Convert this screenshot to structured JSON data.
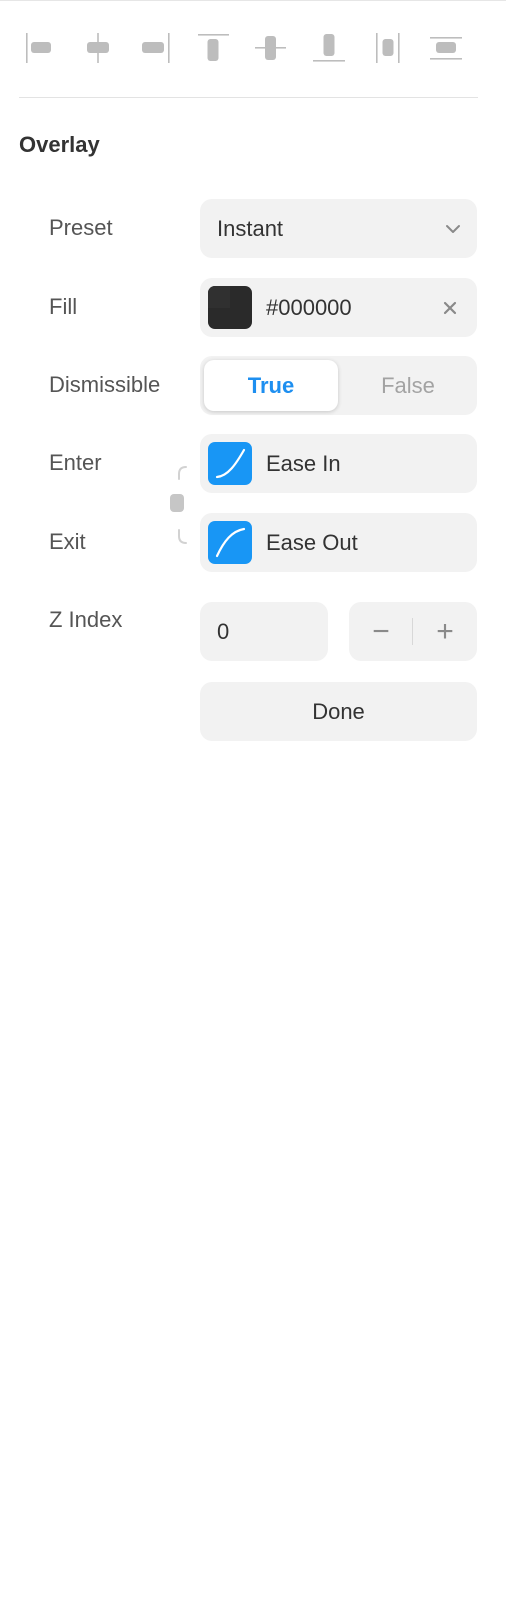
{
  "alignment_toolbar": {
    "buttons": [
      {
        "name": "align-left-icon"
      },
      {
        "name": "align-horizontal-center-icon"
      },
      {
        "name": "align-right-icon"
      },
      {
        "name": "align-top-icon"
      },
      {
        "name": "align-vertical-center-icon"
      },
      {
        "name": "align-bottom-icon"
      },
      {
        "name": "distribute-horizontal-icon"
      },
      {
        "name": "distribute-vertical-icon"
      }
    ]
  },
  "overlay": {
    "title": "Overlay",
    "preset": {
      "label": "Preset",
      "value": "Instant"
    },
    "fill": {
      "label": "Fill",
      "value": "#000000",
      "swatch_color": "#2a2a2a"
    },
    "dismissible": {
      "label": "Dismissible",
      "options": [
        "True",
        "False"
      ],
      "selected": "True"
    },
    "enter": {
      "label": "Enter",
      "value": "Ease In"
    },
    "exit": {
      "label": "Exit",
      "value": "Ease Out"
    },
    "z_index": {
      "label": "Z Index",
      "value": "0",
      "decrement": "−",
      "increment": "+"
    },
    "done_label": "Done"
  },
  "colors": {
    "accent": "#1896f5",
    "active_text": "#1e8ff0",
    "control_bg": "#f2f2f2"
  }
}
